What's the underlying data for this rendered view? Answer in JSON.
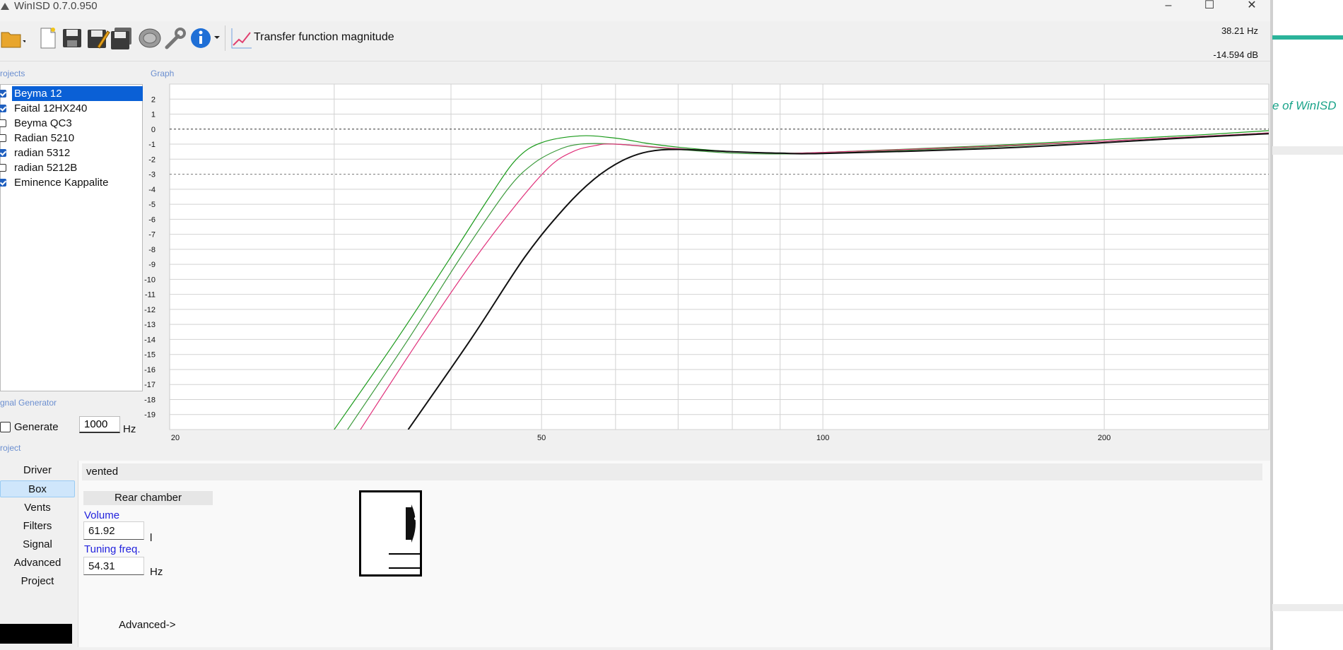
{
  "window": {
    "title": "WinISD 0.7.0.950",
    "buttons": [
      "–",
      "☐",
      "✕"
    ]
  },
  "toolbar": {
    "icons": [
      "open-folder-icon",
      "new-file-icon",
      "save-icon",
      "save-as-icon",
      "save-all-icon",
      "speaker-icon",
      "wrench-icon",
      "info-icon",
      "graph-icon"
    ],
    "graph_type_label": "Transfer function magnitude",
    "cursor_freq": "38.21 Hz",
    "cursor_level": "-14.594 dB"
  },
  "projects": {
    "caption": "rojects",
    "items": [
      {
        "label": "Beyma 12",
        "checked": true,
        "selected": true
      },
      {
        "label": "Faital 12HX240",
        "checked": true,
        "selected": false
      },
      {
        "label": "Beyma QC3",
        "checked": false,
        "selected": false
      },
      {
        "label": "Radian 5210",
        "checked": false,
        "selected": false
      },
      {
        "label": "radian 5312",
        "checked": true,
        "selected": false
      },
      {
        "label": "radian 5212B",
        "checked": false,
        "selected": false
      },
      {
        "label": "Eminence Kappalite",
        "checked": true,
        "selected": false
      }
    ]
  },
  "signal_generator": {
    "caption": "gnal Generator",
    "generate_label": "Generate",
    "frequency": "1000",
    "unit": "Hz"
  },
  "project_nav": {
    "caption": "roject",
    "items": [
      "Driver",
      "Box",
      "Vents",
      "Filters",
      "Signal",
      "Advanced",
      "Project"
    ],
    "active": "Box"
  },
  "box": {
    "type": "vented",
    "chamber_label": "Rear chamber",
    "volume_label": "Volume",
    "volume_value": "61.92",
    "volume_unit": "l",
    "tuning_label": "Tuning freq.",
    "tuning_value": "54.31",
    "tuning_unit": "Hz",
    "advanced_button": "Advanced->"
  },
  "graph": {
    "caption": "Graph"
  },
  "background": {
    "partial_text": "e of WinISD",
    "accent_color": "#2bb39a"
  },
  "chart_data": {
    "type": "line",
    "title": "",
    "x_scale": "log",
    "xlim": [
      20,
      300
    ],
    "ylim": [
      -20,
      3
    ],
    "x_tick_labels": [
      "20",
      "50",
      "100",
      "200"
    ],
    "y_tick_labels": [
      "2",
      "1",
      "0",
      "-1",
      "-2",
      "-3",
      "-4",
      "-5",
      "-6",
      "-7",
      "-8",
      "-9",
      "-10",
      "-11",
      "-12",
      "-13",
      "-14",
      "-15",
      "-16",
      "-17",
      "-18",
      "-19"
    ],
    "reference_lines": [
      0,
      -3
    ],
    "series": [
      {
        "color": "#1a9a1a",
        "width": 1.2,
        "points": [
          [
            30,
            -20
          ],
          [
            35,
            -14
          ],
          [
            40,
            -8.5
          ],
          [
            44,
            -4.5
          ],
          [
            47,
            -2
          ],
          [
            50,
            -0.9
          ],
          [
            55,
            -0.45
          ],
          [
            60,
            -0.6
          ],
          [
            65,
            -0.95
          ],
          [
            70,
            -1.2
          ],
          [
            80,
            -1.5
          ],
          [
            90,
            -1.6
          ],
          [
            100,
            -1.55
          ],
          [
            150,
            -1.1
          ],
          [
            200,
            -0.7
          ],
          [
            250,
            -0.4
          ],
          [
            300,
            -0.1
          ]
        ]
      },
      {
        "color": "#3c9a3c",
        "width": 1.2,
        "points": [
          [
            31,
            -20
          ],
          [
            36,
            -14
          ],
          [
            41,
            -8.5
          ],
          [
            46,
            -4
          ],
          [
            49,
            -2.3
          ],
          [
            52,
            -1.4
          ],
          [
            55,
            -1
          ],
          [
            60,
            -1
          ],
          [
            70,
            -1.35
          ],
          [
            80,
            -1.6
          ],
          [
            90,
            -1.65
          ],
          [
            100,
            -1.6
          ],
          [
            150,
            -1.2
          ],
          [
            200,
            -0.8
          ],
          [
            250,
            -0.5
          ],
          [
            300,
            -0.25
          ]
        ]
      },
      {
        "color": "#e0307a",
        "width": 1.2,
        "points": [
          [
            32,
            -20
          ],
          [
            37,
            -14
          ],
          [
            42,
            -9
          ],
          [
            47,
            -5
          ],
          [
            51,
            -2.5
          ],
          [
            54,
            -1.5
          ],
          [
            57,
            -1.1
          ],
          [
            60,
            -1
          ],
          [
            70,
            -1.3
          ],
          [
            80,
            -1.5
          ],
          [
            90,
            -1.6
          ],
          [
            100,
            -1.55
          ],
          [
            150,
            -1.15
          ],
          [
            200,
            -0.8
          ],
          [
            250,
            -0.5
          ],
          [
            300,
            -0.25
          ]
        ]
      },
      {
        "color": "#111111",
        "width": 2,
        "points": [
          [
            36,
            -20
          ],
          [
            42,
            -14
          ],
          [
            48,
            -8.5
          ],
          [
            53,
            -5.2
          ],
          [
            57,
            -3.3
          ],
          [
            61,
            -2.1
          ],
          [
            65,
            -1.5
          ],
          [
            70,
            -1.35
          ],
          [
            80,
            -1.5
          ],
          [
            90,
            -1.6
          ],
          [
            100,
            -1.62
          ],
          [
            150,
            -1.3
          ],
          [
            200,
            -0.9
          ],
          [
            250,
            -0.55
          ],
          [
            300,
            -0.3
          ]
        ]
      }
    ]
  }
}
